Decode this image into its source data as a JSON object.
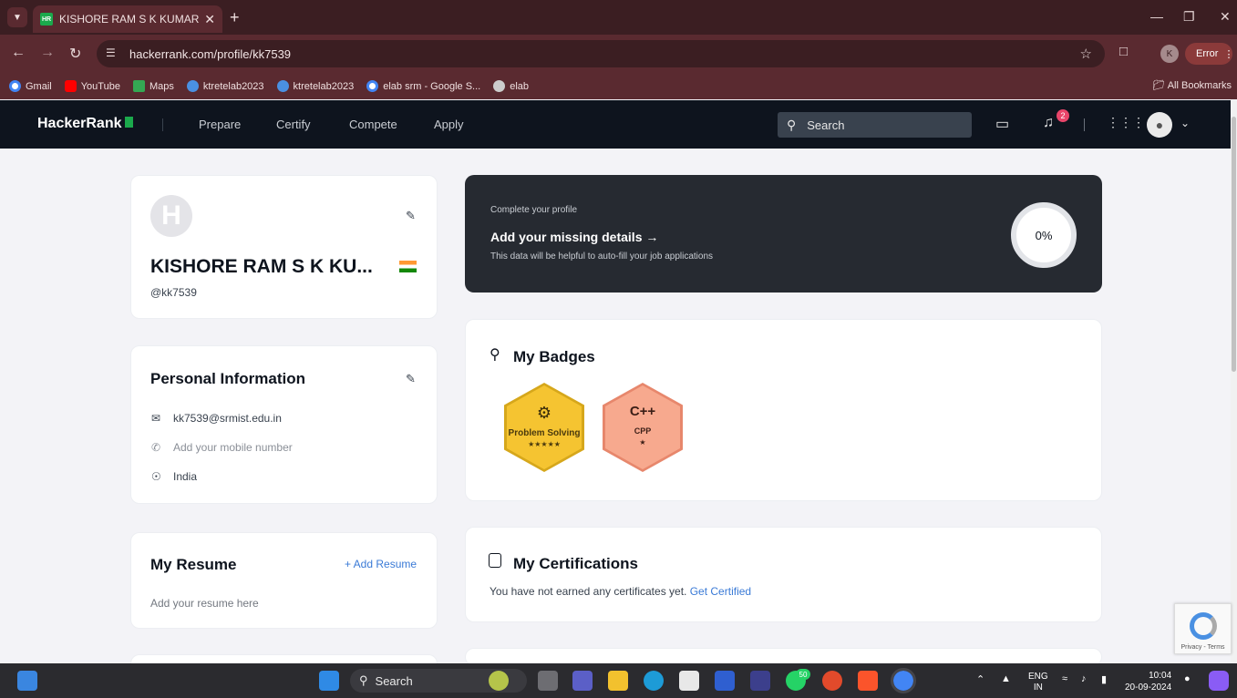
{
  "browser": {
    "tab_title": "KISHORE RAM S K KUMAR (RA",
    "tab_favicon": "HR",
    "url": "hackerrank.com/profile/kk7539",
    "profile_initial": "K",
    "error_label": "Error",
    "bookmarks": [
      {
        "label": "Gmail",
        "icon": "google-icon"
      },
      {
        "label": "YouTube",
        "icon": "youtube-icon"
      },
      {
        "label": "Maps",
        "icon": "maps-icon"
      },
      {
        "label": "ktretelab2023",
        "icon": "cloud-icon"
      },
      {
        "label": "ktretelab2023",
        "icon": "cloud-icon"
      },
      {
        "label": "elab srm - Google S...",
        "icon": "google-icon"
      },
      {
        "label": "elab",
        "icon": "globe-icon"
      }
    ],
    "all_bookmarks_label": "All Bookmarks"
  },
  "nav": {
    "logo": "HackerRank",
    "links": [
      "Prepare",
      "Certify",
      "Compete",
      "Apply"
    ],
    "search_placeholder": "Search",
    "notification_count": "2",
    "accent_color": "#1ba94c"
  },
  "profile": {
    "name": "KISHORE RAM S K KU...",
    "username": "@kk7539",
    "avatar_letter": "H",
    "country_flag": "india-flag-icon"
  },
  "personal_info": {
    "title": "Personal Information",
    "email": "kk7539@srmist.edu.in",
    "phone_placeholder": "Add your mobile number",
    "location": "India"
  },
  "resume": {
    "title": "My Resume",
    "add_label": "+ Add Resume",
    "placeholder": "Add your resume here"
  },
  "complete_profile": {
    "kicker": "Complete your profile",
    "heading": "Add your missing details →",
    "description": "This data will be helpful to auto-fill your job applications",
    "percent": "0%"
  },
  "badges": {
    "title": "My Badges",
    "items": [
      {
        "name": "Problem Solving",
        "stars": "★★★★★",
        "color": "#f5c431"
      },
      {
        "name": "CPP",
        "symbol": "C++",
        "stars": "★",
        "color": "#f7a98e"
      }
    ]
  },
  "certifications": {
    "title": "My Certifications",
    "text": "You have not earned any certificates yet.",
    "link": "Get Certified"
  },
  "recaptcha": {
    "footer": "Privacy - Terms"
  },
  "taskbar": {
    "search_label": "Search",
    "whatsapp_count": "50",
    "lang_top": "ENG",
    "lang_bottom": "IN",
    "time": "10:04",
    "date": "20-09-2024"
  }
}
